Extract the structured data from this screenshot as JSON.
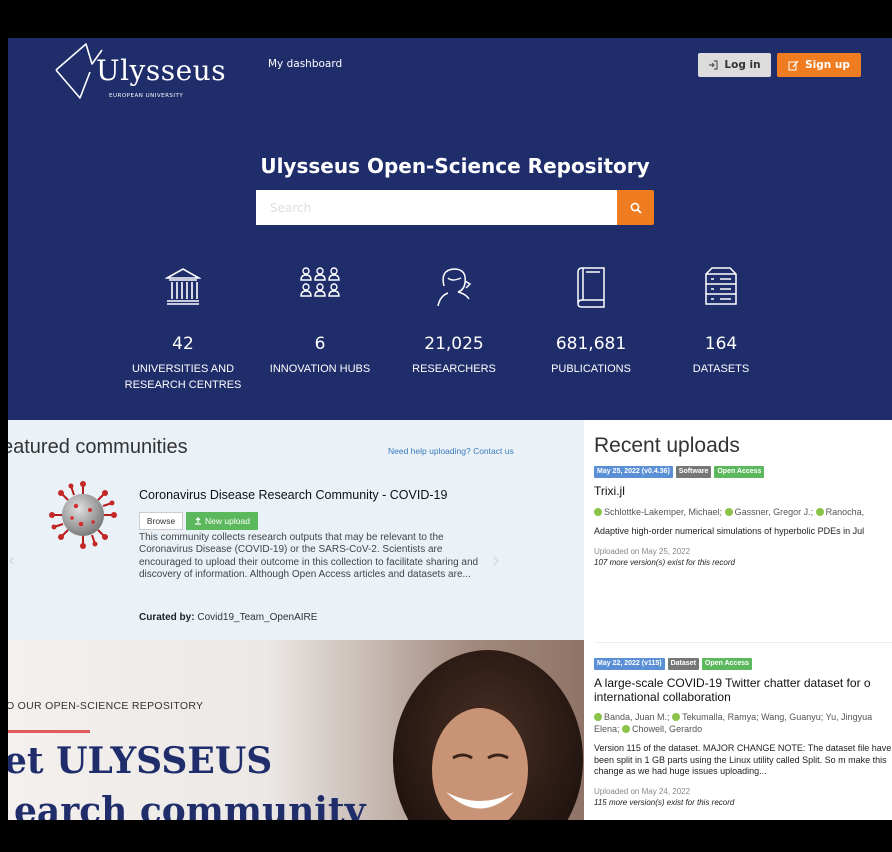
{
  "header": {
    "logo_text": "Ulysseus",
    "logo_subtitle": "EUROPEAN UNIVERSITY",
    "nav_dashboard": "My dashboard",
    "login_label": "Log in",
    "signup_label": "Sign up",
    "colors": {
      "primary": "#1f2d6b",
      "accent": "#f07c22"
    }
  },
  "hero": {
    "title": "Ulysseus Open-Science Repository",
    "search_placeholder": "Search"
  },
  "stats": [
    {
      "icon": "university-icon",
      "value": "42",
      "label": "UNIVERSITIES AND RESEARCH CENTRES"
    },
    {
      "icon": "people-grid-icon",
      "value": "6",
      "label": "INNOVATION HUBS"
    },
    {
      "icon": "researcher-icon",
      "value": "21,025",
      "label": "RESEARCHERS"
    },
    {
      "icon": "publications-icon",
      "value": "681,681",
      "label": "PUBLICATIONS"
    },
    {
      "icon": "database-icon",
      "value": "164",
      "label": "DATASETS"
    }
  ],
  "featured": {
    "title": "eatured communities",
    "help_link": "Need help uploading? Contact us",
    "community_title": "Coronavirus Disease Research Community - COVID-19",
    "browse_label": "Browse",
    "new_upload_label": "New upload",
    "description": "This community collects research outputs that may be relevant to the Coronavirus Disease (COVID-19) or the SARS-CoV-2. Scientists are encouraged to upload their outcome in this collection to facilitate sharing and discovery of information. Although Open Access articles and datasets are...",
    "curated_label": "Curated by:",
    "curated_value": "Covid19_Team_OpenAIRE"
  },
  "banner": {
    "kicker": "O OUR OPEN-SCIENCE REPOSITORY",
    "headline1": "et ULYSSEUS",
    "headline2": "earch community"
  },
  "recent": {
    "title": "Recent uploads",
    "records": [
      {
        "date_badge": "May 25, 2022 (v0.4.36)",
        "type_badge": "Software",
        "access_badge": "Open Access",
        "title": "Trixi.jl",
        "authors": [
          "Schlottke-Lakemper, Michael;",
          "Gassner, Gregor J.;",
          "Ranocha,"
        ],
        "description": "Adaptive high-order numerical simulations of hyperbolic PDEs in Jul",
        "uploaded": "Uploaded on May 25, 2022",
        "versions": "107 more version(s) exist for this record"
      },
      {
        "date_badge": "May 22, 2022 (v115)",
        "type_badge": "Dataset",
        "access_badge": "Open Access",
        "title": "A large-scale COVID-19 Twitter chatter dataset for o international collaboration",
        "authors_line1a": "Banda, Juan M.;",
        "authors_line1b": "Tekumalla, Ramya; Wang, Guanyu; Yu, Jingyua",
        "authors_line2a": "Elena;",
        "authors_line2b": "Chowell, Gerardo",
        "description": "Version 115 of the dataset. MAJOR CHANGE NOTE: The dataset file have been split in 1 GB parts using the Linux utility called Split. So m make this change as we had huge issues uploading...",
        "uploaded": "Uploaded on May 24, 2022",
        "versions": "115 more version(s) exist for this record"
      }
    ]
  }
}
